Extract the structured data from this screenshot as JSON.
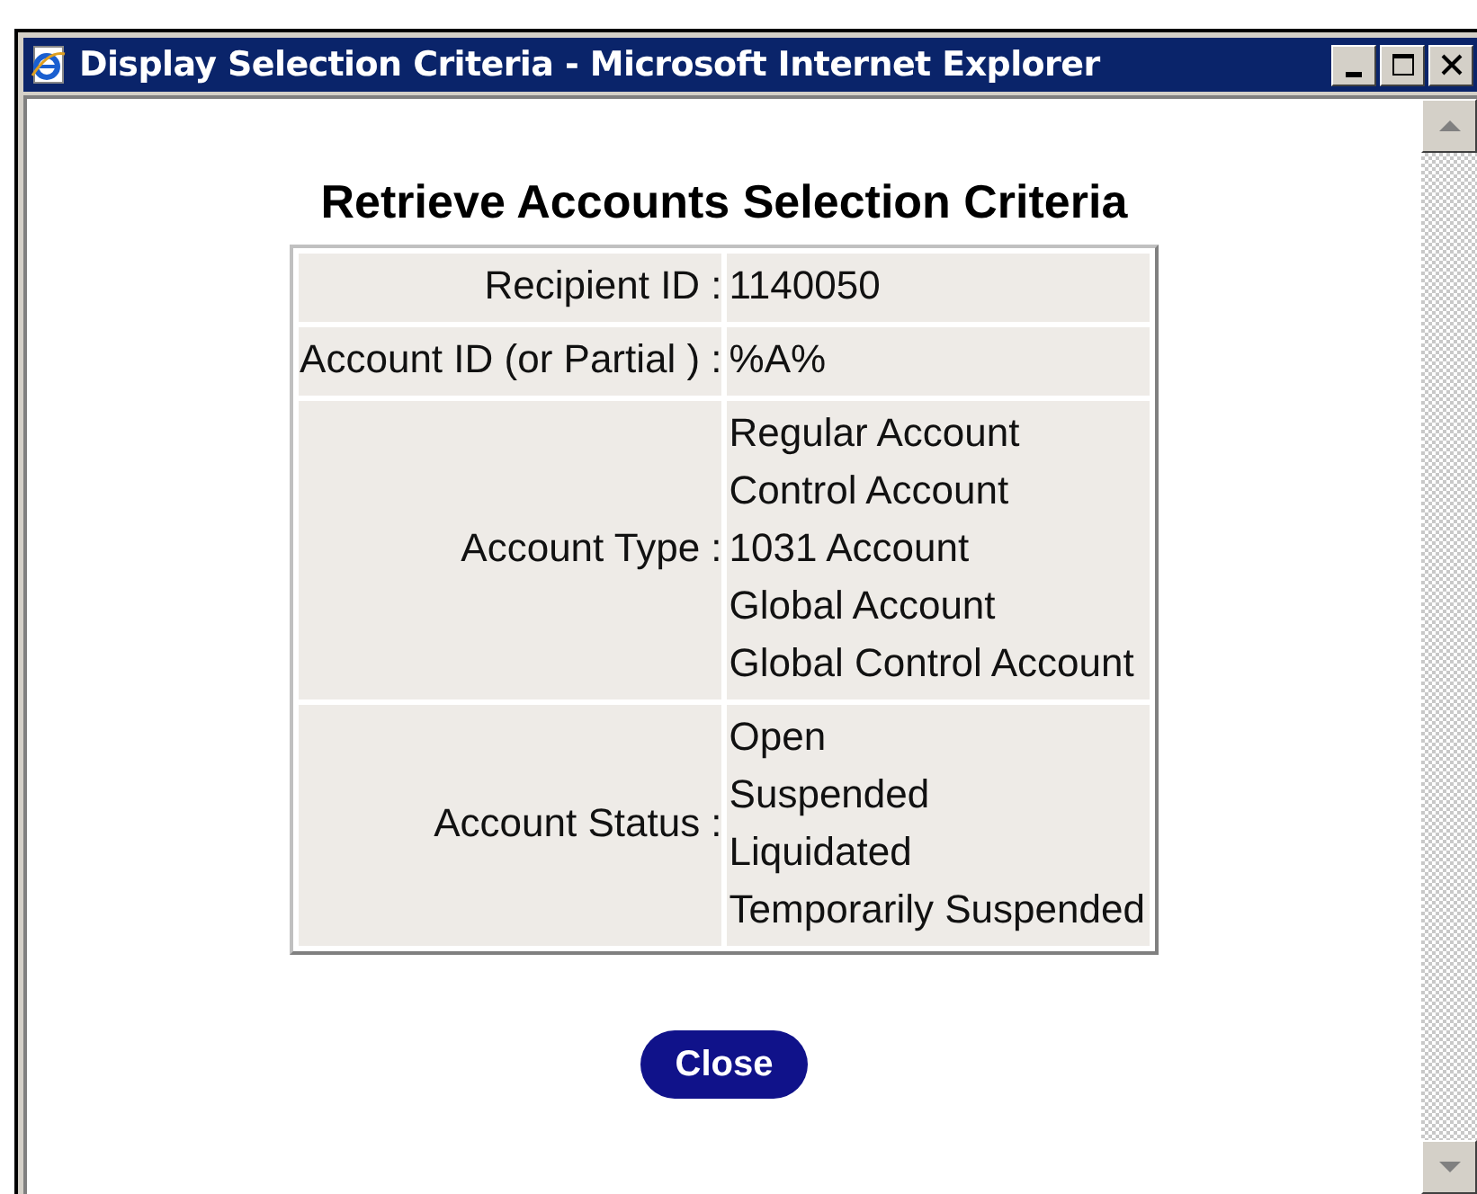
{
  "window": {
    "title": "Display Selection Criteria - Microsoft Internet Explorer"
  },
  "heading": "Retrieve Accounts Selection Criteria",
  "criteria": [
    {
      "label": "Recipient ID :",
      "values": [
        "1140050"
      ]
    },
    {
      "label": "Account ID (or Partial ) :",
      "values": [
        "%A%"
      ]
    },
    {
      "label": "Account Type :",
      "values": [
        "Regular Account",
        "Control Account",
        "1031 Account",
        "Global Account",
        "Global Control Account"
      ]
    },
    {
      "label": "Account Status :",
      "values": [
        "Open",
        "Suspended",
        "Liquidated",
        "Temporarily Suspended"
      ]
    }
  ],
  "buttons": [
    "Close"
  ]
}
